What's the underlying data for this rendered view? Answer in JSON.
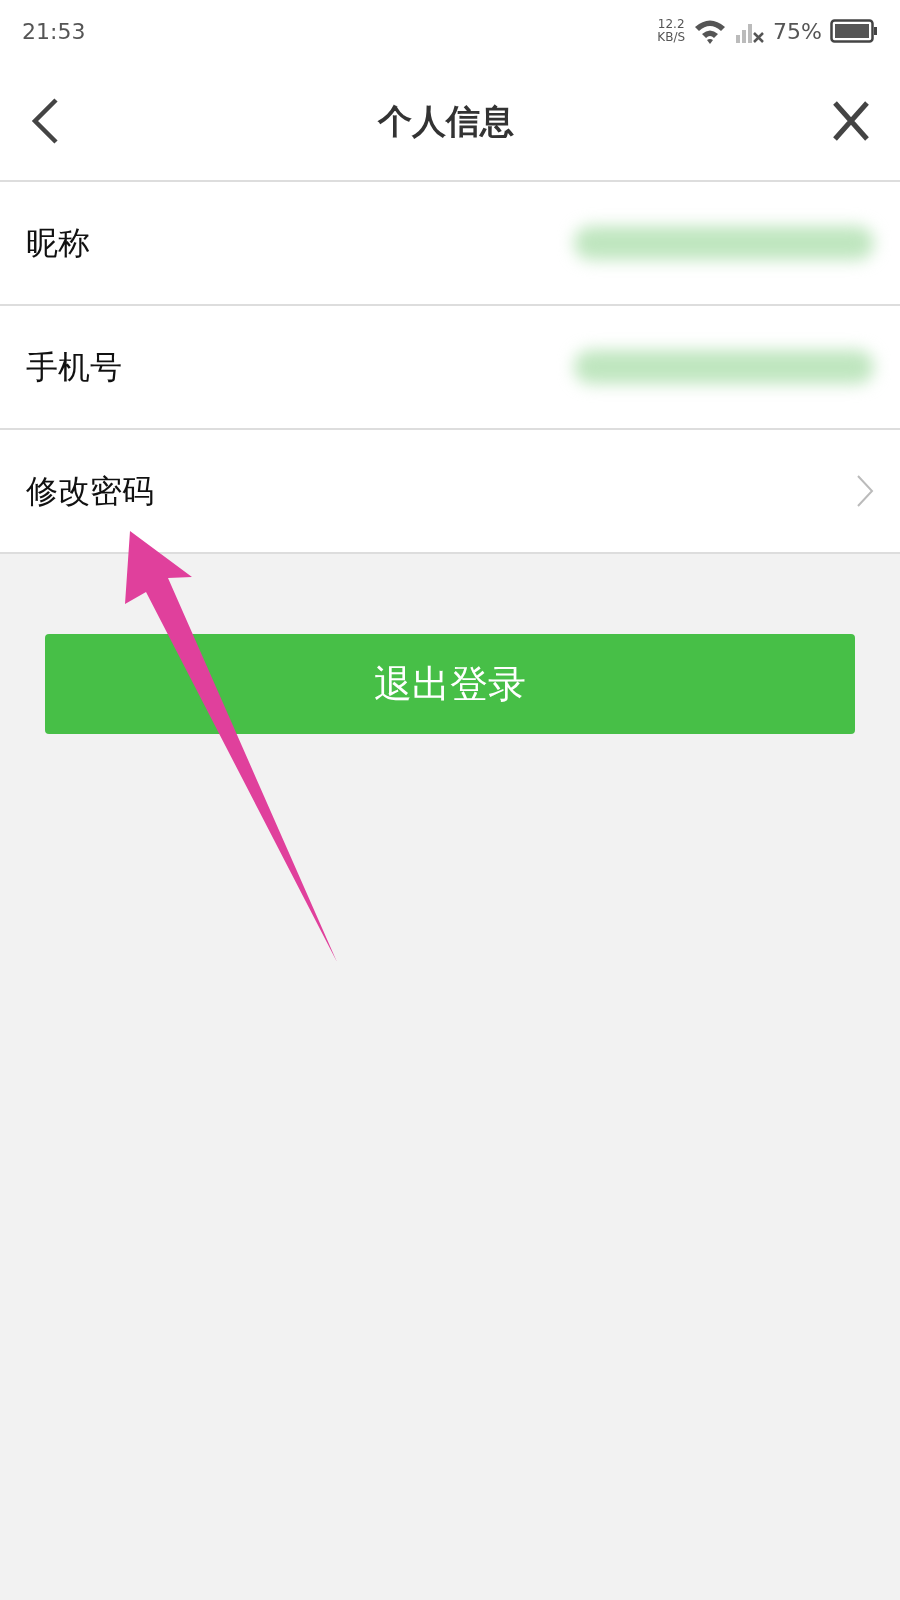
{
  "status_bar": {
    "time": "21:53",
    "speed_value": "12.2",
    "speed_unit": "KB/S",
    "battery": "75%"
  },
  "header": {
    "title": "个人信息"
  },
  "rows": [
    {
      "label": "昵称",
      "kind": "value"
    },
    {
      "label": "手机号",
      "kind": "value"
    },
    {
      "label": "修改密码",
      "kind": "link"
    }
  ],
  "logout_button": "退出登录"
}
